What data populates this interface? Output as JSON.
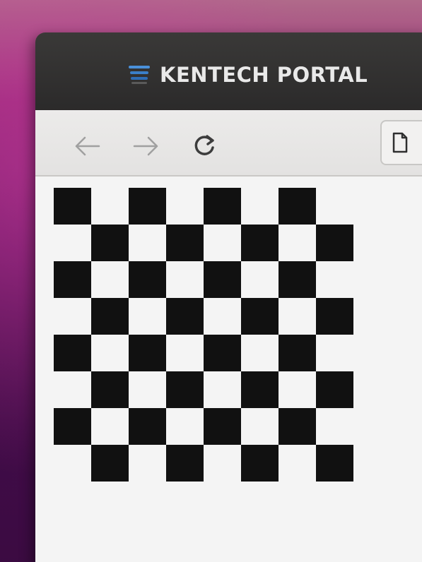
{
  "window": {
    "title": "KENTECH PORTAL"
  },
  "toolbar": {
    "back_icon": "arrow-left-icon",
    "forward_icon": "arrow-right-icon",
    "reload_icon": "reload-icon",
    "page_icon": "page-icon"
  },
  "content": {
    "pattern": "checkerboard",
    "rows": 8,
    "cols": 8,
    "dark_color": "#111111",
    "light_color": "#f4f4f4"
  },
  "colors": {
    "titlebar": "#2b2a2a",
    "toolbar": "#e8e7e6",
    "accent": "#4a90d9"
  }
}
